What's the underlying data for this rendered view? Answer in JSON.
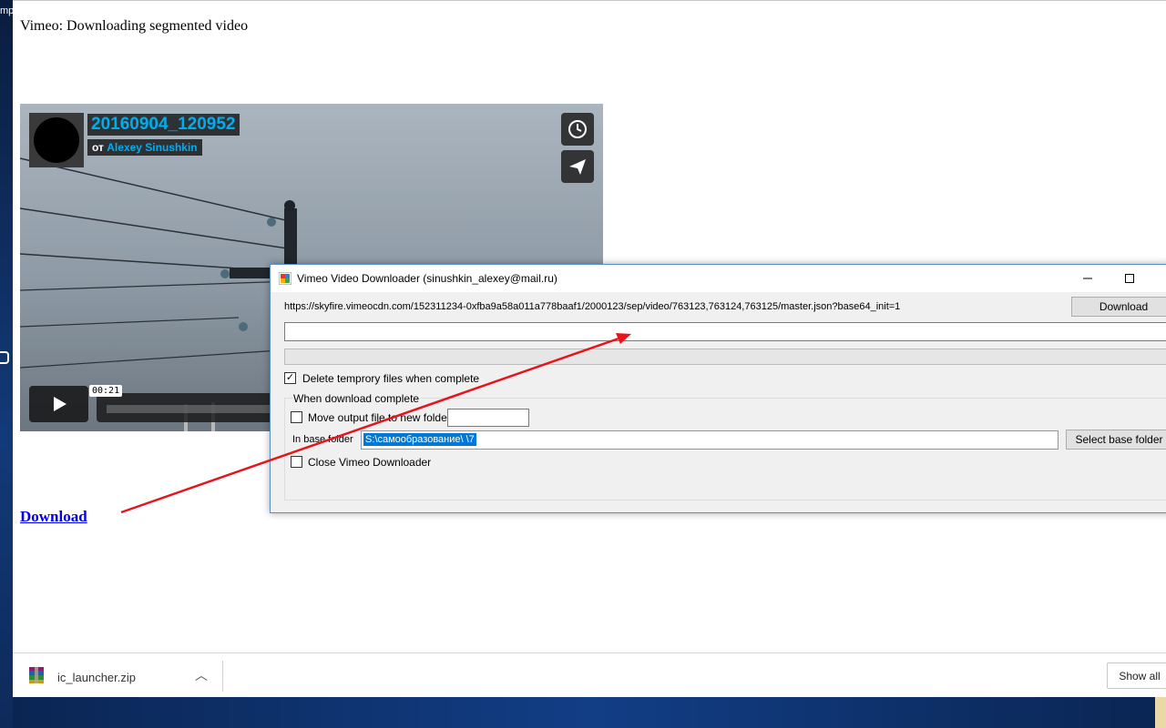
{
  "desktop": {
    "edge_text": "mp"
  },
  "browser": {
    "page_heading": "Vimeo: Downloading segmented video",
    "download_link": "Download"
  },
  "player": {
    "video_title": "20160904_120952",
    "byline_prefix": "от",
    "author": "Alexey Sinushkin",
    "timecode": "00:21",
    "icons": {
      "later": "clock-icon",
      "share": "paper-plane-icon",
      "play": "play-icon"
    },
    "accent_color": "#00adef"
  },
  "dialog": {
    "title": "Vimeo Video Downloader (sinushkin_alexey@mail.ru)",
    "url": "https://skyfire.vimeocdn.com/152311234-0xfba9a58a011a778baaf1/2000123/sep/video/763123,763124,763125/master.json?base64_init=1",
    "download_button": "Download",
    "delete_temp_label": "Delete temprory files when complete",
    "delete_temp_checked": true,
    "group_label": "When download complete",
    "move_output_label": "Move output file to new folder",
    "move_output_checked": false,
    "move_output_value": "",
    "base_folder_label": "In base folder",
    "base_folder_value": "S:\\самообразование\\                          \\7",
    "select_base_button": "Select base folder",
    "close_app_label": "Close Vimeo Downloader",
    "close_app_checked": false
  },
  "downloads_shelf": {
    "file_name": "ic_launcher.zip",
    "show_all": "Show all"
  }
}
